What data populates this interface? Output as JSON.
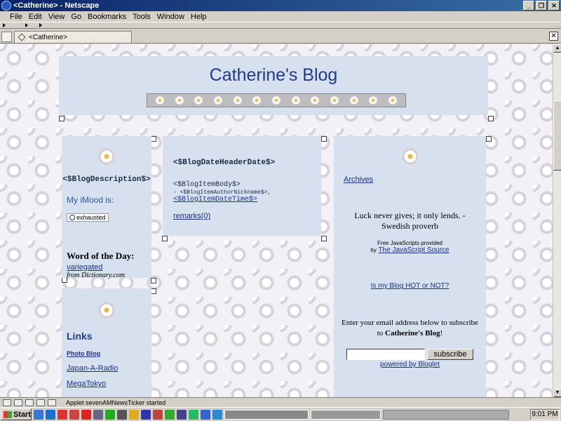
{
  "window": {
    "title": "<Catherine> - Netscape"
  },
  "menu": [
    "File",
    "Edit",
    "View",
    "Go",
    "Bookmarks",
    "Tools",
    "Window",
    "Help"
  ],
  "tab": {
    "label": "<Catherine>"
  },
  "page": {
    "blog_title": "Catherine's Blog",
    "sidebar": {
      "description": "<$BlogDescription$>",
      "imood_label": "My iMood is:",
      "mood": "exhausted",
      "wotd_title": "Word of the Day:",
      "wotd_word": "variegated",
      "wotd_from": "from Dictionary.com"
    },
    "links": {
      "title": "Links",
      "items": [
        "Photo Blog",
        "Japan-A-Radio",
        "MegaTokyo"
      ]
    },
    "post": {
      "date_header": "<$BlogDateHeaderDate$>",
      "body": "<$BlogItemBody$>",
      "author": "- <$BlogItemAuthorNickname$>,",
      "datetime": "<$BlogItemDateTime$>",
      "remarks": "remarks(0)"
    },
    "right": {
      "archives": "Archives",
      "quote": "Luck never gives; it only lends. -Swedish proverb",
      "js_provided": "Free JavaScripts provided",
      "js_by": "by",
      "js_source": "The JavaScript Source",
      "hot_or_not": "Is my Blog HOT or NOT?",
      "subscribe_text_1": "Enter your email address below to subscribe to",
      "subscribe_blog": "Catherine's Blog",
      "subscribe_text_2": "!",
      "subscribe_button": "subscribe",
      "powered_by": "powered by Bloglet"
    }
  },
  "status": {
    "text": "Applet sevenAMNewsTicker started"
  },
  "taskbar": {
    "start": "Start",
    "clock": "9:01 PM"
  }
}
